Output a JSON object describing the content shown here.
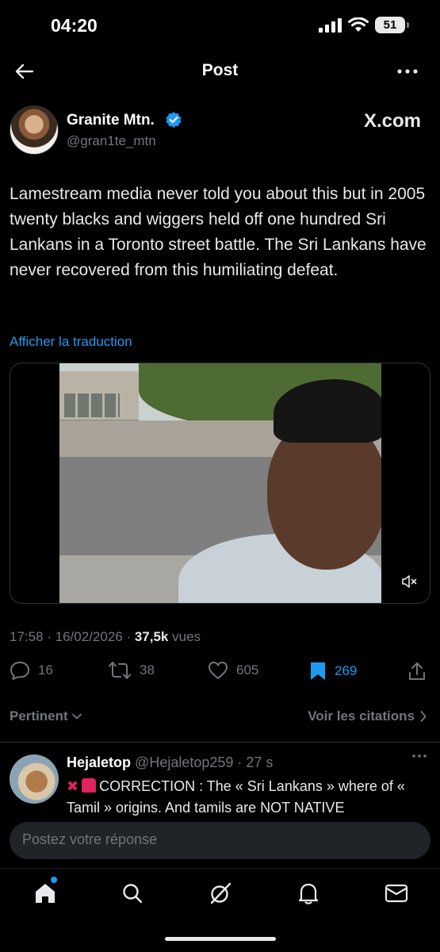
{
  "status_bar": {
    "time": "04:20",
    "battery": "51"
  },
  "header": {
    "title": "Post"
  },
  "author": {
    "name": "Granite Mtn.",
    "handle": "@gran1te_mtn",
    "watermark": "X.com"
  },
  "tweet": {
    "text": "Lamestream media never told you about this but in 2005 twenty blacks and wiggers held off one hundred Sri Lankans in a Toronto street battle. The Sri Lankans have never recovered from this humiliating defeat.",
    "translate": "Afficher la traduction"
  },
  "meta": {
    "date": "17:58 · 16/02/2026 · ",
    "views": "37,5k",
    "views_label": " vues"
  },
  "actions": {
    "replies": "16",
    "reposts": "38",
    "likes": "605",
    "bookmarks": "269"
  },
  "sort": {
    "label": "Pertinent",
    "citations": "Voir les citations"
  },
  "reply": {
    "name": "Hejaletop",
    "handle": "@Hejaletop259",
    "time": " · 27 s",
    "text": "CORRECTION : The « Sri Lankans » where of « Tamil » origins. And tamils are NOT NATIVE"
  },
  "compose": {
    "placeholder": "Postez votre réponse"
  },
  "colors": {
    "accent": "#1d9bf0",
    "background": "#000000",
    "muted": "#71767b"
  },
  "icons": [
    "back-arrow-icon",
    "more-icon",
    "verified-icon",
    "mute-icon",
    "reply-icon",
    "repost-icon",
    "like-icon",
    "bookmark-icon",
    "share-icon",
    "home-icon",
    "search-icon",
    "grok-icon",
    "bell-icon",
    "mail-icon"
  ]
}
